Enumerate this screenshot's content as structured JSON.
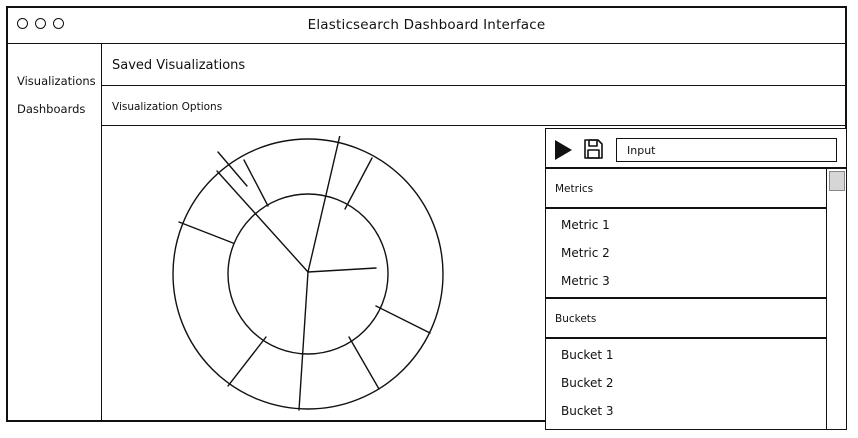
{
  "window": {
    "title": "Elasticsearch Dashboard Interface"
  },
  "sidebar": {
    "items": [
      {
        "label": "Visualizations"
      },
      {
        "label": "Dashboards"
      }
    ]
  },
  "header": {
    "saved_title": "Saved Visualizations",
    "options_label": "Visualization Options"
  },
  "toolbar": {
    "play_icon": "play-icon",
    "save_icon": "save-icon",
    "input_placeholder": "Input"
  },
  "metrics": {
    "title": "Metrics",
    "items": [
      "Metric 1",
      "Metric 2",
      "Metric 3"
    ]
  },
  "buckets": {
    "title": "Buckets",
    "items": [
      "Bucket 1",
      "Bucket 2",
      "Bucket 3"
    ]
  },
  "colors": {
    "stroke": "#111111",
    "background": "#ffffff",
    "scroll_thumb": "#d6d6d6"
  }
}
